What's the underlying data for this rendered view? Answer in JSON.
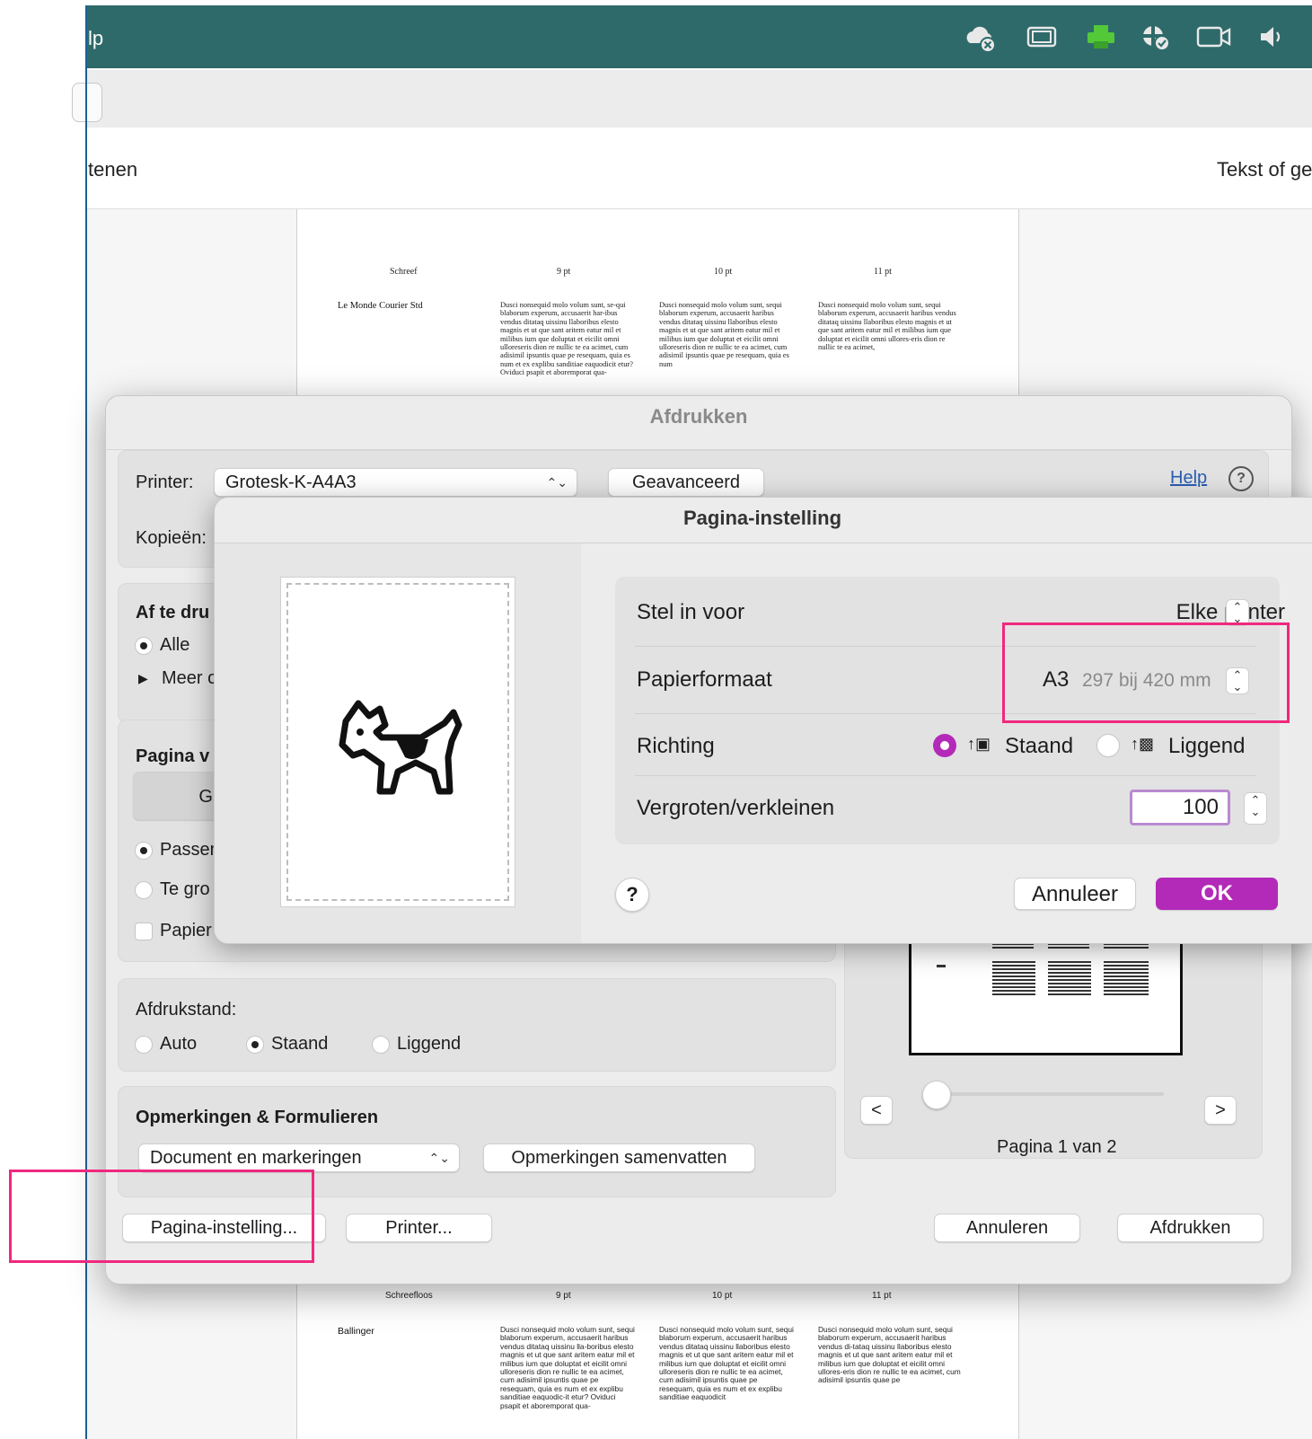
{
  "app": {
    "title_fragment": "lp",
    "toolbar_left_fragment": "tenen",
    "toolbar_right_fragment": "Tekst of ge",
    "toolbar_icons": [
      "cloud-offline-icon",
      "screen-icon",
      "printer-icon",
      "security-shield-icon",
      "camera-icon",
      "speaker-icon"
    ],
    "accent_color": "#2f6a6a"
  },
  "document": {
    "top_table": {
      "headers": [
        "Schreef",
        "9 pt",
        "10 pt",
        "11 pt"
      ],
      "font_name": "Le Monde Courier Std",
      "col1": "Dusci nonsequid molo volum sunt, se-qui blaborum experum, accusaerit har-ibus vendus ditataq uissinu llaboribus elesto magnis et ut que sant aritem eatur mil et milibus ium que doluptat et eicilit omni ulloreseris dion re nullic te ea acimet, cum adisimil ipsuntis quae pe resequam, quia es num et ex explibu sanditiae eaquodicit etur? Oviduci psapit et aboremporat qua-",
      "col2": "Dusci nonsequid molo volum sunt, sequi blaborum experum, accusaerit haribus vendus ditataq uissinu llaboribus elesto magnis et ut que sant aritem eatur mil et milibus ium que doluptat et eicilit omni ulloreseris dion re nullic te ea acimet, cum adisimil ipsuntis quae pe resequam, quia es num",
      "col3": "Dusci nonsequid molo volum sunt, sequi blaborum experum, accusaerit haribus vendus ditataq uissinu llaboribus elesto magnis et ut que sant aritem eatur mil et milibus ium que doluptat et eicilit omni ullores-eris dion re nullic te ea acimet,"
    },
    "bottom_table": {
      "headers": [
        "Schreefloos",
        "9 pt",
        "10 pt",
        "11 pt"
      ],
      "font_name": "Ballinger",
      "col1": "Dusci nonsequid molo volum sunt, sequi blaborum experum, accusaerit haribus vendus ditataq uissinu lla-boribus elesto magnis et ut que sant aritem eatur mil et milibus ium que doluptat et eicilit omni ulloreseris dion re nullic te ea acimet, cum adisimil ipsuntis quae pe resequam, quia es num et ex explibu sanditiae eaquodic-it etur? Oviduci psapit et aboremporat qua-",
      "col2": "Dusci nonsequid molo volum sunt, sequi blaborum experum, accusaerit haribus vendus ditataq uissinu llaboribus elesto magnis et ut que sant aritem eatur mil et milibus ium que doluptat et eicilit omni ulloreseris dion re nullic te ea acimet, cum adisimil ipsuntis quae pe resequam, quia es num et ex explibu sanditiae eaquodicit",
      "col3": "Dusci nonsequid molo volum sunt, sequi blaborum experum, accusaerit haribus vendus di-tataq uissinu llaboribus elesto magnis et ut que sant aritem eatur mil et milibus ium que doluptat et eicilit omni ullores-eris dion re nullic te ea acimet, cum adisimil ipsuntis quae pe"
    }
  },
  "print_dialog": {
    "title": "Afdrukken",
    "printer_label": "Printer:",
    "printer_value": "Grotesk-K-A4A3",
    "advanced_button": "Geavanceerd",
    "help_link": "Help",
    "help_icon": "?",
    "copies_label": "Kopieën:",
    "pages_section": {
      "title": "Af te dru",
      "option_all": "Alle",
      "option_more": "Meer o",
      "selected": "Alle"
    },
    "sizing_section": {
      "title": "Pagina v",
      "button_fragment": "Gro",
      "option_fit": "Passen",
      "option_too_large": "Te gro",
      "checkbox_paper": "Papier",
      "selected": "Passen"
    },
    "orientation_section": {
      "title": "Afdrukstand:",
      "options": [
        "Auto",
        "Staand",
        "Liggend"
      ],
      "selected": "Staand"
    },
    "comments_section": {
      "title": "Opmerkingen & Formulieren",
      "select_value": "Document en markeringen",
      "summarize_button": "Opmerkingen samenvatten"
    },
    "preview": {
      "prev_button": "<",
      "next_button": ">",
      "page_indicator": "Pagina 1 van 2",
      "slider_position": 0.0
    },
    "footer": {
      "page_setup_button": "Pagina-instelling...",
      "printer_button": "Printer...",
      "cancel_button": "Annuleren",
      "print_button": "Afdrukken"
    }
  },
  "page_setup_sheet": {
    "title": "Pagina-instelling",
    "preview_icon": "dogcow-icon",
    "rows": {
      "format_for_label": "Stel in voor",
      "format_for_value": "Elke printer",
      "paper_size_label": "Papierformaat",
      "paper_size_value": "A3",
      "paper_size_detail": "297 bij 420 mm",
      "orientation_label": "Richting",
      "orientation_portrait": "Staand",
      "orientation_landscape": "Liggend",
      "orientation_selected": "Staand",
      "scale_label": "Vergroten/verkleinen",
      "scale_value": "100"
    },
    "help_button": "?",
    "cancel_button": "Annuleer",
    "ok_button": "OK",
    "ok_color": "#b32ab8",
    "highlight_color": "#f0287e"
  }
}
